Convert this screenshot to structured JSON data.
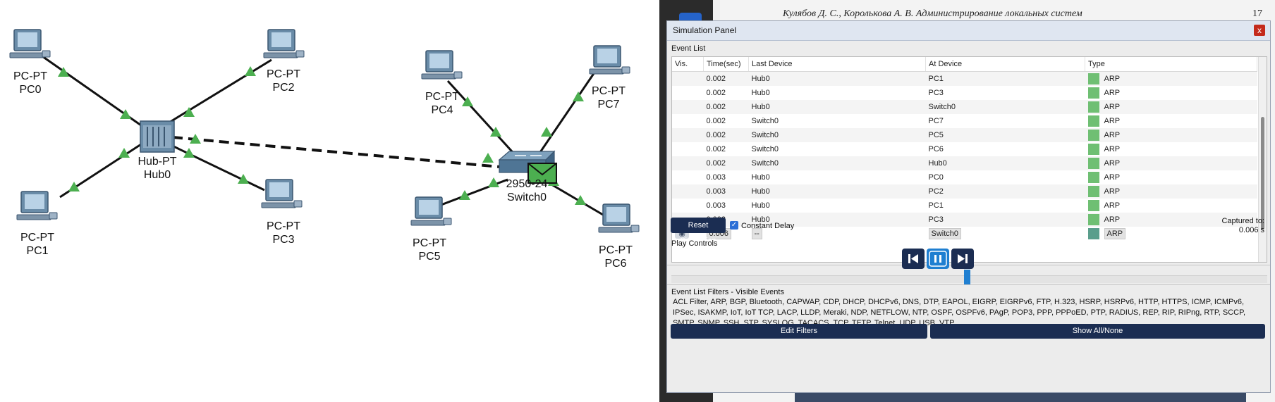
{
  "topology": {
    "devices": [
      {
        "id": "pc0",
        "model": "PC-PT",
        "name": "PC0"
      },
      {
        "id": "pc1",
        "model": "PC-PT",
        "name": "PC1"
      },
      {
        "id": "pc2",
        "model": "PC-PT",
        "name": "PC2"
      },
      {
        "id": "pc3",
        "model": "PC-PT",
        "name": "PC3"
      },
      {
        "id": "pc4",
        "model": "PC-PT",
        "name": "PC4"
      },
      {
        "id": "pc5",
        "model": "PC-PT",
        "name": "PC5"
      },
      {
        "id": "pc6",
        "model": "PC-PT",
        "name": "PC6"
      },
      {
        "id": "pc7",
        "model": "PC-PT",
        "name": "PC7"
      },
      {
        "id": "hub0",
        "model": "Hub-PT",
        "name": "Hub0"
      },
      {
        "id": "switch0",
        "model": "2950-24",
        "name": "Switch0"
      }
    ],
    "link_color": "#111111",
    "port_up_color": "#4caf50",
    "envelope_color": "#4caf50"
  },
  "background_doc": {
    "header": "Кулябов Д. С., Королькова А. В. Администрирование локальных систем",
    "page_number": "17"
  },
  "panel": {
    "title": "Simulation Panel",
    "close_label": "x",
    "event_list_label": "Event List",
    "columns": [
      "Vis.",
      "Time(sec)",
      "Last Device",
      "At Device",
      "Type"
    ],
    "events": [
      {
        "vis": "",
        "time": "0.002",
        "last": "Hub0",
        "at": "PC1",
        "type": "ARP",
        "color": "#6fbf73"
      },
      {
        "vis": "",
        "time": "0.002",
        "last": "Hub0",
        "at": "PC3",
        "type": "ARP",
        "color": "#6fbf73"
      },
      {
        "vis": "",
        "time": "0.002",
        "last": "Hub0",
        "at": "Switch0",
        "type": "ARP",
        "color": "#6fbf73"
      },
      {
        "vis": "",
        "time": "0.002",
        "last": "Switch0",
        "at": "PC7",
        "type": "ARP",
        "color": "#6fbf73"
      },
      {
        "vis": "",
        "time": "0.002",
        "last": "Switch0",
        "at": "PC5",
        "type": "ARP",
        "color": "#6fbf73"
      },
      {
        "vis": "",
        "time": "0.002",
        "last": "Switch0",
        "at": "PC6",
        "type": "ARP",
        "color": "#6fbf73"
      },
      {
        "vis": "",
        "time": "0.002",
        "last": "Switch0",
        "at": "Hub0",
        "type": "ARP",
        "color": "#6fbf73"
      },
      {
        "vis": "",
        "time": "0.003",
        "last": "Hub0",
        "at": "PC0",
        "type": "ARP",
        "color": "#6fbf73"
      },
      {
        "vis": "",
        "time": "0.003",
        "last": "Hub0",
        "at": "PC2",
        "type": "ARP",
        "color": "#6fbf73"
      },
      {
        "vis": "",
        "time": "0.003",
        "last": "Hub0",
        "at": "PC1",
        "type": "ARP",
        "color": "#6fbf73"
      },
      {
        "vis": "",
        "time": "0.003",
        "last": "Hub0",
        "at": "PC3",
        "type": "ARP",
        "color": "#6fbf73"
      },
      {
        "vis": "eye",
        "time": "0.006",
        "last": "--",
        "at": "Switch0",
        "type": "ARP",
        "color": "#5a9e8c",
        "current": true
      }
    ],
    "reset_label": "Reset Simulation",
    "constant_delay_label": "Constant Delay",
    "constant_delay_checked": true,
    "captured_label": "Captured to:",
    "captured_value": "0.006 s",
    "play_controls_label": "Play Controls",
    "filters_label": "Event List Filters - Visible Events",
    "filters_text": "ACL Filter, ARP, BGP, Bluetooth, CAPWAP, CDP, DHCP, DHCPv6, DNS, DTP, EAPOL, EIGRP, EIGRPv6, FTP, H.323, HSRP, HSRPv6, HTTP, HTTPS, ICMP, ICMPv6, IPSec, ISAKMP, IoT, IoT TCP, LACP, LLDP, Meraki, NDP, NETFLOW, NTP, OSPF, OSPFv6, PAgP, POP3, PPP, PPPoED, PTP, RADIUS, REP, RIP, RIPng, RTP, SCCP, SMTP, SNMP, SSH, STP, SYSLOG, TACACS, TCP, TFTP, Telnet, UDP, USB, VTP",
    "edit_filters_label": "Edit Filters",
    "show_all_label": "Show All/None"
  }
}
